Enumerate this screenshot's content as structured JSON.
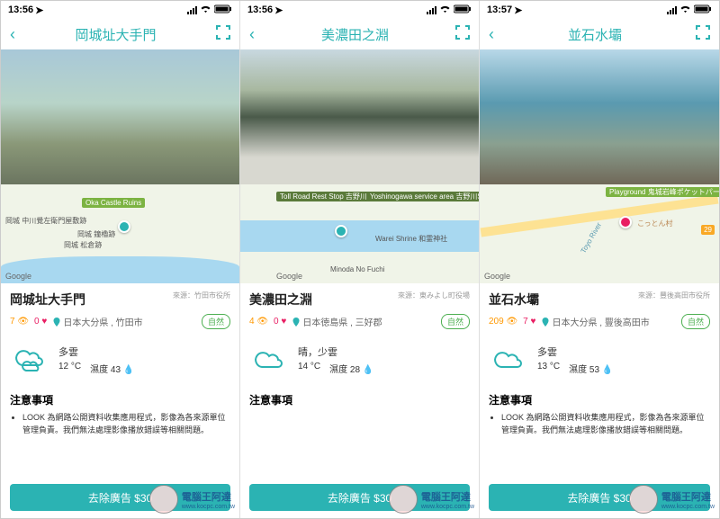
{
  "status": {
    "time1": "13:56",
    "time2": "13:56",
    "time3": "13:57"
  },
  "screens": [
    {
      "title": "岡城址大手門",
      "location_name": "岡城址大手門",
      "source": "來源：竹田市役所",
      "views": "7",
      "likes": "0",
      "address": "日本大分県 , 竹田市",
      "tag": "自然",
      "weather": {
        "condition": "多雲",
        "temp": "12 °C",
        "humidity": "濕度 43"
      },
      "notes_title": "注意事項",
      "notes": "LOOK 為網路公開資料收集應用程式，影像為各來源單位管理負責。我們無法處理影像播放錯誤等相關問題。",
      "cta": "去除廣告 $30",
      "map_labels": [
        "Oka Castle Ruins",
        "岡城 中川覺左衛門屋敷跡",
        "岡城 鐘櫓跡",
        "岡城 松倉跡"
      ]
    },
    {
      "title": "美濃田之淵",
      "location_name": "美濃田之淵",
      "source": "來源：東みよし町役場",
      "views": "4",
      "likes": "0",
      "address": "日本徳島県 , 三好郡",
      "tag": "自然",
      "weather": {
        "condition": "晴，少雲",
        "temp": "14 °C",
        "humidity": "濕度 28"
      },
      "notes_title": "注意事項",
      "notes": "",
      "cta": "去除廣告 $30",
      "map_labels": [
        "Toll Road Rest Stop 吉野川ハイウェイオアシス",
        "Yoshinogawa service area 吉野川SA (下り)",
        "Warei Shrine 和霊神社",
        "Minoda No Fuchi"
      ]
    },
    {
      "title": "並石水壩",
      "location_name": "並石水壩",
      "source": "來源：豐後高田市役所",
      "views": "209",
      "likes": "7",
      "address": "日本大分県 , 豐後高田市",
      "tag": "自然",
      "weather": {
        "condition": "多雲",
        "temp": "13 °C",
        "humidity": "濕度 53"
      },
      "notes_title": "注意事項",
      "notes": "LOOK 為網路公開資料收集應用程式，影像為各來源單位管理負責。我們無法處理影像播放錯誤等相關問題。",
      "cta": "去除廣告 $30",
      "map_labels": [
        "Playground 鬼城岩峰ポケットパーク",
        "こっとん村",
        "29",
        "Toyo River"
      ]
    }
  ],
  "watermark": {
    "text": "電腦王阿達",
    "url": "www.kocpc.com.tw"
  },
  "google_label": "Google"
}
